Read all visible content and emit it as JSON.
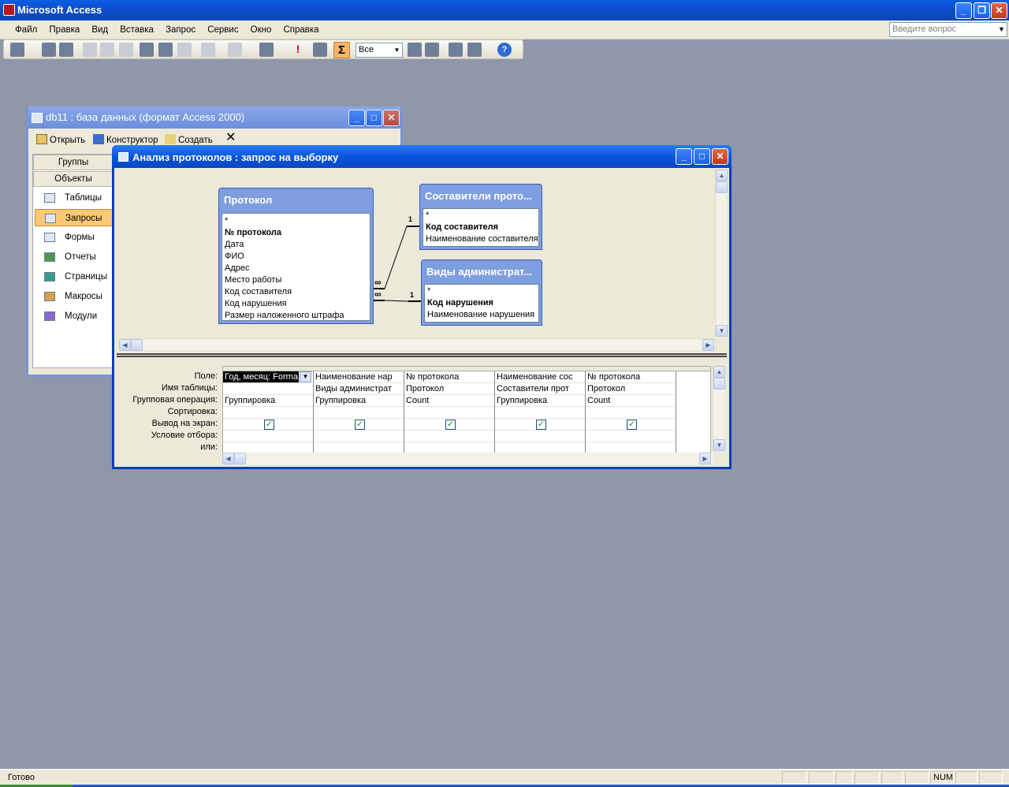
{
  "app": {
    "title": "Microsoft Access"
  },
  "menu": {
    "items": [
      "Файл",
      "Правка",
      "Вид",
      "Вставка",
      "Запрос",
      "Сервис",
      "Окно",
      "Справка"
    ],
    "ask_placeholder": "Введите вопрос"
  },
  "toolbar": {
    "top_values": "Все",
    "sigma": "Σ"
  },
  "db_window": {
    "title": "db11 : база данных (формат Access 2000)",
    "toolbar": {
      "open": "Открыть",
      "design": "Конструктор",
      "create": "Создать"
    },
    "groups_label": "Группы",
    "objects_label": "Объекты",
    "objects": [
      "Таблицы",
      "Запросы",
      "Формы",
      "Отчеты",
      "Страницы",
      "Макросы",
      "Модули"
    ],
    "selected_object": "Запросы"
  },
  "query_window": {
    "title": "Анализ протоколов : запрос на выборку",
    "tables": [
      {
        "title": "Протокол",
        "fields": [
          "*",
          "№ протокола",
          "Дата",
          "ФИО",
          "Адрес",
          "Место работы",
          "Код составителя",
          "Код нарушения",
          "Размер наложенного штрафа"
        ],
        "key_fields": [
          "№ протокола"
        ]
      },
      {
        "title": "Составители прото...",
        "fields": [
          "*",
          "Код составителя",
          "Наименование составителя"
        ],
        "key_fields": [
          "Код составителя"
        ]
      },
      {
        "title": "Виды администрат...",
        "fields": [
          "*",
          "Код нарушения",
          "Наименование нарушения"
        ],
        "key_fields": [
          "Код нарушения"
        ]
      }
    ],
    "relations": [
      {
        "from": "Код составителя",
        "to": "Код составителя",
        "many": "∞",
        "one": "1"
      },
      {
        "from": "Код нарушения",
        "to": "Код нарушения",
        "many": "∞",
        "one": "1"
      }
    ],
    "grid_labels": [
      "Поле:",
      "Имя таблицы:",
      "Групповая операция:",
      "Сортировка:",
      "Вывод на экран:",
      "Условие отбора:",
      "или:"
    ],
    "grid_columns": [
      {
        "field": "Год, месяц: Forma",
        "table": "",
        "total": "Группировка",
        "sort": "",
        "show": true
      },
      {
        "field": "Наименование нар",
        "table": "Виды администрат",
        "total": "Группировка",
        "sort": "",
        "show": true
      },
      {
        "field": "№ протокола",
        "table": "Протокол",
        "total": "Count",
        "sort": "",
        "show": true
      },
      {
        "field": "Наименование сос",
        "table": "Составители прот",
        "total": "Группировка",
        "sort": "",
        "show": true
      },
      {
        "field": "№ протокола",
        "table": "Протокол",
        "total": "Count",
        "sort": "",
        "show": true
      }
    ]
  },
  "status": {
    "text": "Готово",
    "num": "NUM"
  }
}
